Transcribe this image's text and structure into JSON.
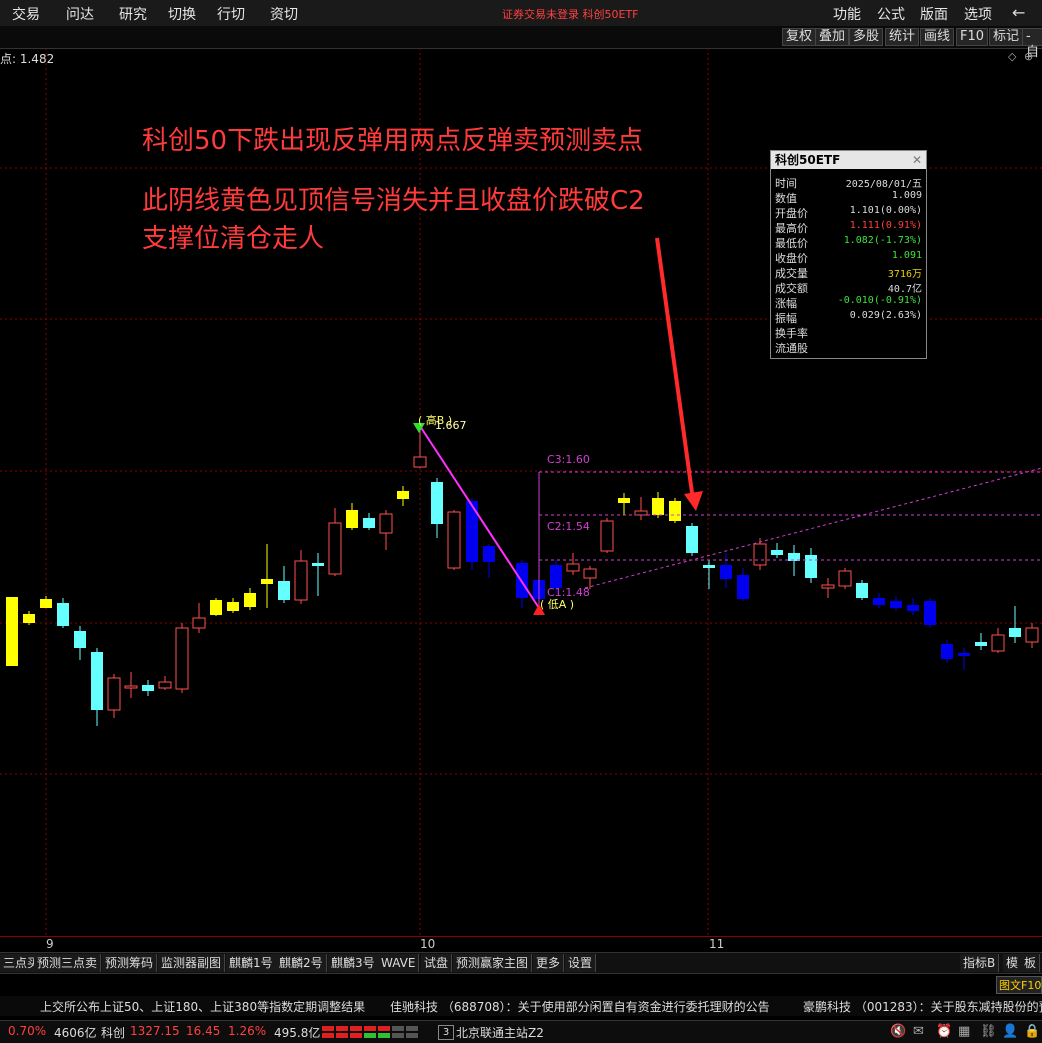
{
  "menu": {
    "items": [
      "交易",
      "问达",
      "研究",
      "切换",
      "行切",
      "资切"
    ],
    "title": "证券交易未登录  科创50ETF",
    "right": [
      "功能",
      "公式",
      "版面",
      "选项"
    ]
  },
  "toolbar2": {
    "buttons": [
      "复权",
      "叠加",
      "多股",
      "统计",
      "画线",
      "F10",
      "标记",
      "-自"
    ]
  },
  "price_label": "点: 1.482",
  "annotations": {
    "line1": "科创50下跌出现反弹用两点反弹卖预测卖点",
    "line2": "此阴线黄色见顶信号消失并且收盘价跌破C2",
    "line3": "支撑位清仓走人"
  },
  "markers": {
    "high_label": "( 高B )",
    "high_value": "1.667",
    "low_label": "( 低A )",
    "c3": "C3:1.60",
    "c2": "C2:1.54",
    "c1": "C1:1.48"
  },
  "info_box": {
    "title": "科创50ETF",
    "rows": [
      {
        "label": "时间",
        "value": "2025/08/01/五",
        "color": "#dddddd"
      },
      {
        "label": "数值",
        "value": "1.009",
        "color": "#dddddd"
      },
      {
        "label": "开盘价",
        "value": "1.101(0.00%)",
        "color": "#dddddd"
      },
      {
        "label": "最高价",
        "value": "1.111(0.91%)",
        "color": "#ff4040"
      },
      {
        "label": "最低价",
        "value": "1.082(-1.73%)",
        "color": "#40e040"
      },
      {
        "label": "收盘价",
        "value": "1.091",
        "color": "#40e040"
      },
      {
        "label": "成交量",
        "value": "3716万",
        "color": "#e6d200"
      },
      {
        "label": "成交额",
        "value": "40.7亿",
        "color": "#dddddd"
      },
      {
        "label": "涨幅",
        "value": "-0.010(-0.91%)",
        "color": "#40e040"
      },
      {
        "label": "振幅",
        "value": "0.029(2.63%)",
        "color": "#dddddd"
      },
      {
        "label": "换手率",
        "value": "",
        "color": "#dddddd"
      },
      {
        "label": "流通股",
        "value": "",
        "color": "#dddddd"
      }
    ]
  },
  "date_axis": [
    "9",
    "10",
    "11"
  ],
  "tabs": {
    "left": [
      "三点买",
      "预测三点卖",
      "预测筹码",
      "监测器副图",
      "麒麟1号",
      "麒麟2号",
      "麒麟3号",
      "WAVE",
      "试盘",
      "预测赢家主图",
      "更多",
      "设置"
    ],
    "right": [
      "指标B",
      "模",
      "板"
    ]
  },
  "side_label": "图文F10",
  "news": [
    "上交所公布上证50、上证180、上证380等指数定期调整结果",
    "佳驰科技 （688708）：关于使用部分闲置自有资金进行委托理财的公告",
    "豪鹏科技 （001283）：关于股东减持股份的预"
  ],
  "status": {
    "pct1": "0.70%",
    "amt1": "4606亿",
    "name2": "科创",
    "val2": "1327.15",
    "chg2": "16.45",
    "pct2": "1.26%",
    "amt2": "495.8亿",
    "badge": "3",
    "station": "北京联通主站Z2"
  },
  "colors": {
    "up": "#ff5050",
    "down_cyan": "#66ffff",
    "down_blue": "#0000ee",
    "yellow": "#ffff00",
    "magenta": "#d040d0",
    "grid": "#8b0000",
    "annotation": "#ff3b3b"
  },
  "chart_data": {
    "type": "candlestick",
    "candles": [
      {
        "type": "yellow"
      },
      {
        "type": "yellow"
      },
      {
        "type": "yellow"
      },
      {
        "type": "cyan"
      },
      {
        "type": "cyan"
      },
      {
        "type": "cyan"
      },
      {
        "type": "up"
      },
      {
        "type": "up"
      },
      {
        "type": "cyan"
      },
      {
        "type": "up"
      },
      {
        "type": "up"
      },
      {
        "type": "up"
      },
      {
        "type": "yellow"
      },
      {
        "type": "yellow"
      },
      {
        "type": "yellow"
      },
      {
        "type": "yellow"
      },
      {
        "type": "cyan"
      },
      {
        "type": "up"
      },
      {
        "type": "cyan"
      },
      {
        "type": "up"
      },
      {
        "type": "yellow"
      },
      {
        "type": "cyan"
      },
      {
        "type": "up"
      },
      {
        "type": "yellow"
      },
      {
        "type": "up"
      },
      {
        "type": "cyan"
      },
      {
        "type": "up"
      },
      {
        "type": "blue"
      },
      {
        "type": "blue"
      },
      {
        "type": "blue"
      },
      {
        "type": "blue"
      },
      {
        "type": "blue"
      },
      {
        "type": "up"
      },
      {
        "type": "up"
      },
      {
        "type": "up"
      },
      {
        "type": "yellow"
      },
      {
        "type": "up"
      },
      {
        "type": "yellow"
      },
      {
        "type": "yellow"
      },
      {
        "type": "cyan"
      },
      {
        "type": "cyan"
      },
      {
        "type": "blue"
      },
      {
        "type": "blue"
      },
      {
        "type": "up"
      },
      {
        "type": "cyan"
      },
      {
        "type": "cyan"
      },
      {
        "type": "cyan"
      },
      {
        "type": "up"
      },
      {
        "type": "up"
      },
      {
        "type": "cyan"
      },
      {
        "type": "blue"
      },
      {
        "type": "blue"
      },
      {
        "type": "blue"
      },
      {
        "type": "blue"
      },
      {
        "type": "blue"
      },
      {
        "type": "blue"
      },
      {
        "type": "cyan"
      },
      {
        "type": "up"
      },
      {
        "type": "cyan"
      },
      {
        "type": "up"
      }
    ]
  }
}
